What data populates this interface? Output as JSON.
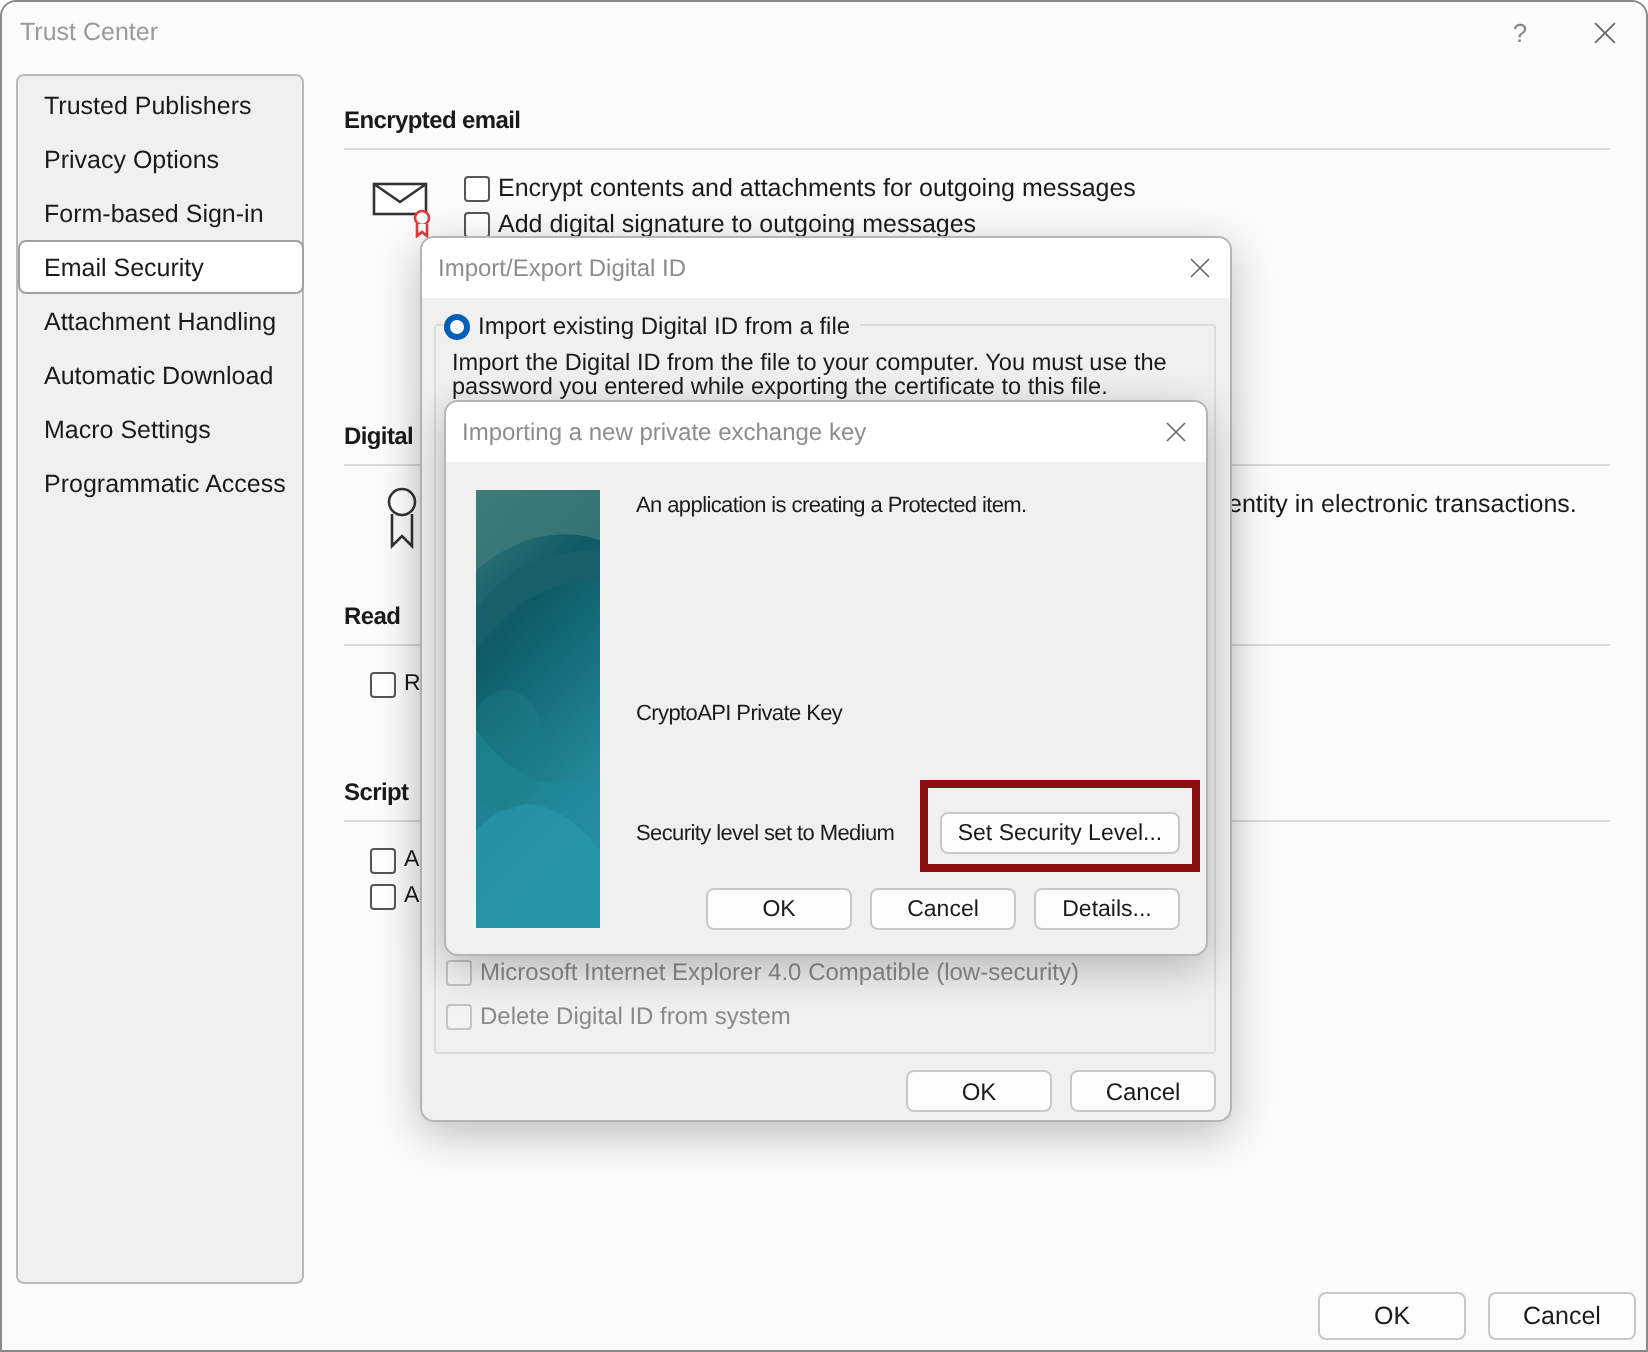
{
  "window": {
    "title": "Trust Center",
    "help": "?"
  },
  "sidebar": {
    "items": [
      {
        "label": "Trusted Publishers",
        "selected": false
      },
      {
        "label": "Privacy Options",
        "selected": false
      },
      {
        "label": "Form-based Sign-in",
        "selected": false
      },
      {
        "label": "Email Security",
        "selected": true
      },
      {
        "label": "Attachment Handling",
        "selected": false
      },
      {
        "label": "Automatic Download",
        "selected": false
      },
      {
        "label": "Macro Settings",
        "selected": false
      },
      {
        "label": "Programmatic Access",
        "selected": false
      }
    ]
  },
  "sections": [
    {
      "heading": "Encrypted email",
      "kind": "envelope",
      "options": [
        {
          "label": "Encrypt contents and attachments for outgoing messages",
          "checked": false
        },
        {
          "label": "Add digital signature to outgoing messages",
          "checked": false
        }
      ]
    },
    {
      "heading": "Digital",
      "kind": "certificate",
      "text": "entity in electronic transactions."
    },
    {
      "heading": "Read",
      "kind": "plain",
      "options": [
        {
          "label": "R",
          "checked": false
        }
      ]
    },
    {
      "heading": "Script",
      "kind": "plain",
      "options": [
        {
          "label": "A",
          "checked": false
        },
        {
          "label": "A",
          "checked": false
        }
      ]
    }
  ],
  "buttons": [
    "OK",
    "Cancel"
  ],
  "dialog1": {
    "title": "Import/Export Digital ID",
    "radio": {
      "label": "Import existing Digital ID from a file",
      "selected": true
    },
    "description": "Import the Digital ID from the file to your computer. You must use the password you entered while exporting the certificate to this file.",
    "options": [
      {
        "label": "Microsoft Internet Explorer 4.0 Compatible (low-security)",
        "checked": false,
        "disabled": true
      },
      {
        "label": "Delete Digital ID from system",
        "checked": false,
        "disabled": true
      }
    ],
    "buttons": [
      "OK",
      "Cancel"
    ]
  },
  "dialog2": {
    "title": "Importing a new private exchange key",
    "message": "An application is creating a Protected item.",
    "key_name": "CryptoAPI Private Key",
    "security_level": "Security level set to Medium",
    "set_level_button": {
      "label": "Set Security Level...",
      "highlighted": true
    },
    "buttons": [
      "OK",
      "Cancel",
      "Details..."
    ]
  }
}
